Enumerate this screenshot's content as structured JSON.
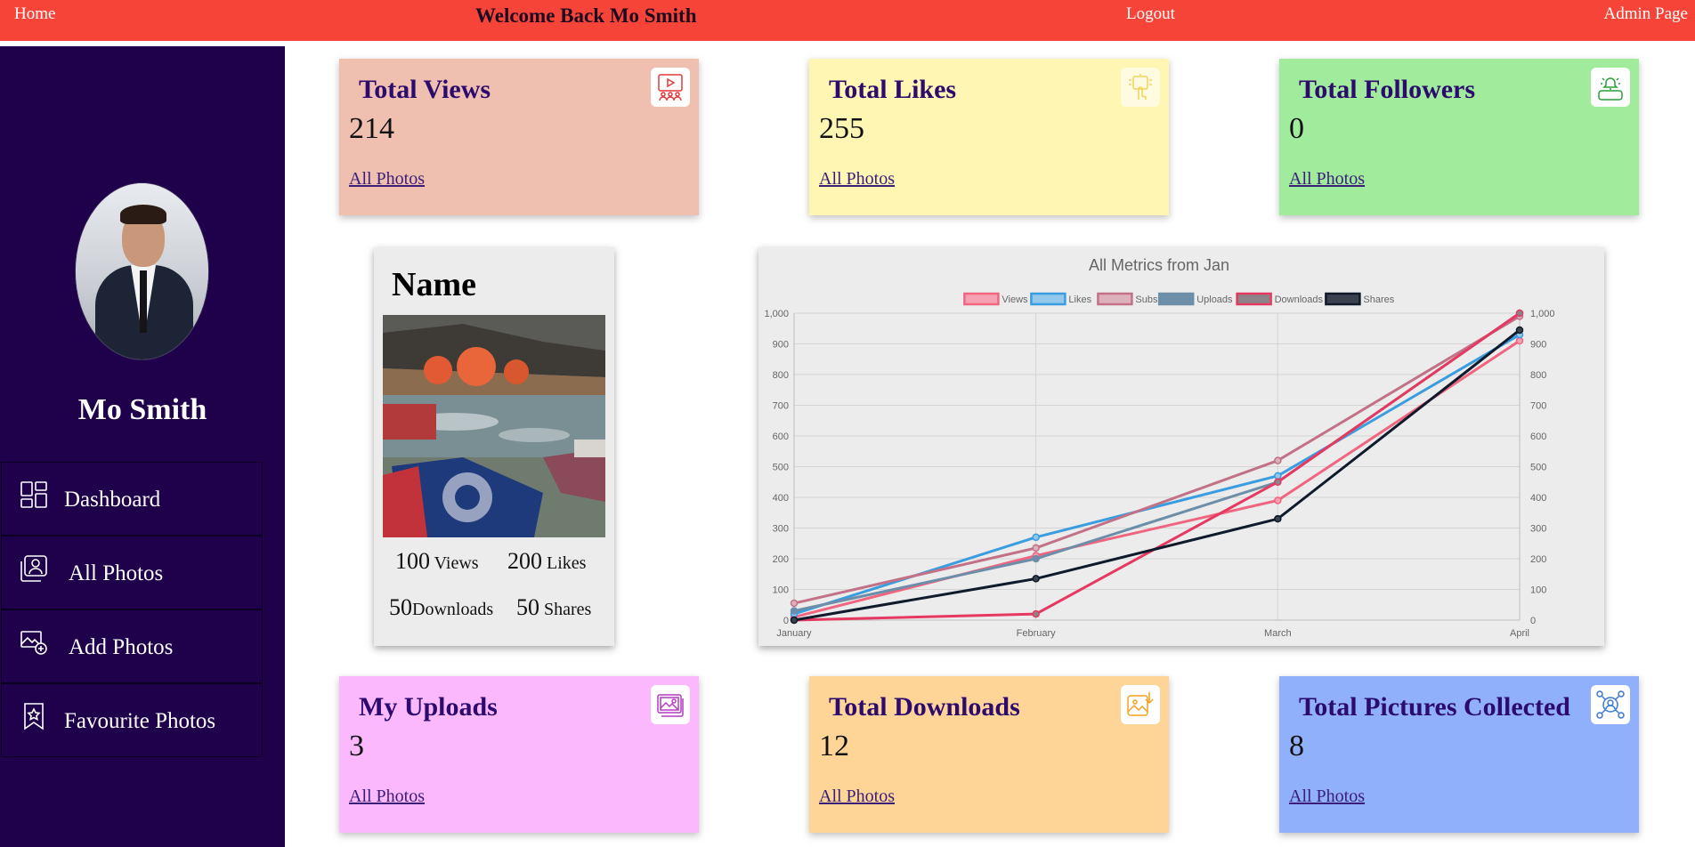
{
  "topbar": {
    "home": "Home",
    "welcome": "Welcome Back Mo Smith",
    "logout": "Logout",
    "admin": "Admin Page"
  },
  "sidebar": {
    "username": "Mo Smith",
    "items": [
      {
        "label": "Dashboard",
        "icon": "dashboard-icon"
      },
      {
        "label": "All Photos",
        "icon": "photos-icon"
      },
      {
        "label": "Add Photos",
        "icon": "add-photo-icon"
      },
      {
        "label": "Favourite Photos",
        "icon": "bookmark-star-icon"
      }
    ]
  },
  "cards": {
    "views": {
      "title": "Total Views",
      "value": "214",
      "link": "All Photos",
      "color": "#efc0b0",
      "icon": "video-presentation-icon"
    },
    "likes": {
      "title": "Total Likes",
      "value": "255",
      "link": "All Photos",
      "color": "#fff6b4",
      "icon": "touch-screen-icon"
    },
    "followers": {
      "title": "Total Followers",
      "value": "0",
      "link": "All Photos",
      "color": "#a0eb9c",
      "icon": "subscribe-bell-icon"
    },
    "uploads": {
      "title": "My Uploads",
      "value": "3",
      "link": "All Photos",
      "color": "#fbb8fc",
      "icon": "image-gallery-icon"
    },
    "downloads": {
      "title": "Total Downloads",
      "value": "12",
      "link": "All Photos",
      "color": "#fed597",
      "icon": "image-download-icon"
    },
    "collected": {
      "title": "Total Pictures Collected",
      "value": "8",
      "link": "All Photos",
      "color": "#90b0fc",
      "icon": "network-user-icon"
    }
  },
  "photo_card": {
    "name": "Name",
    "views_n": "100",
    "views_l": "Views",
    "likes_n": "200",
    "likes_l": "Likes",
    "downloads_n": "50",
    "downloads_l": "Downloads",
    "shares_n": "50",
    "shares_l": "Shares"
  },
  "chart_data": {
    "type": "line",
    "title": "All Metrics from Jan",
    "categories": [
      "January",
      "February",
      "March",
      "April"
    ],
    "ylim": [
      0,
      1000
    ],
    "yticks": [
      "0",
      "100",
      "200",
      "300",
      "400",
      "500",
      "600",
      "700",
      "800",
      "900",
      "1,000"
    ],
    "grid": true,
    "legend_position": "top",
    "series": [
      {
        "name": "Views",
        "values": [
          10,
          210,
          390,
          910
        ],
        "color": "#f0657f",
        "fill": "#f6a1b1"
      },
      {
        "name": "Likes",
        "values": [
          20,
          270,
          470,
          930
        ],
        "color": "#3a9ddf",
        "fill": "#92c8ec"
      },
      {
        "name": "Subs",
        "values": [
          55,
          235,
          520,
          990
        ],
        "color": "#c27186",
        "fill": "#dcb1bc"
      },
      {
        "name": "Uploads",
        "values": [
          30,
          200,
          450,
          1000
        ],
        "color": "#6d8ea8",
        "fill": "#6d8ea8"
      },
      {
        "name": "Downloads",
        "values": [
          0,
          20,
          450,
          1000
        ],
        "color": "#e63962",
        "fill": "#8a8488"
      },
      {
        "name": "Shares",
        "values": [
          0,
          135,
          330,
          945
        ],
        "color": "#0f1a2a",
        "fill": "#3a4250"
      }
    ]
  }
}
